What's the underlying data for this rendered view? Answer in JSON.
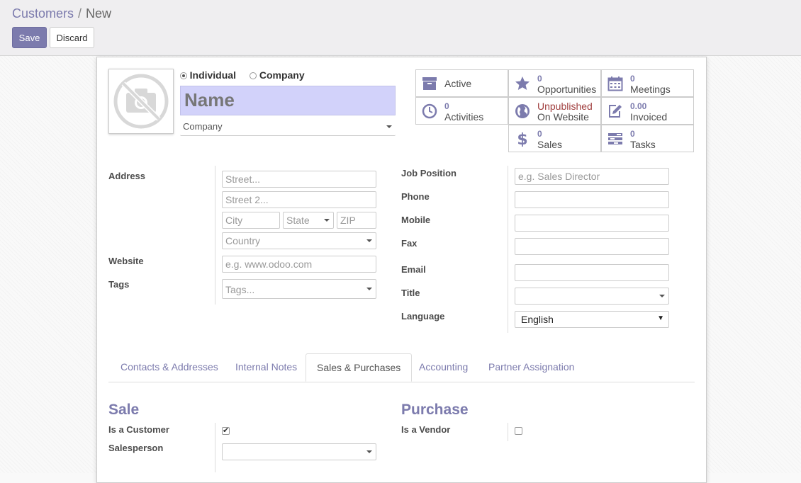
{
  "breadcrumb": {
    "parent": "Customers",
    "separator": "/",
    "current": "New"
  },
  "buttons": {
    "save": "Save",
    "discard": "Discard"
  },
  "partner_type": {
    "individual": "Individual",
    "company": "Company",
    "selected": "Individual"
  },
  "name_placeholder": "Name",
  "company_placeholder": "Company",
  "stats": {
    "active": {
      "label": "Active",
      "icon": "archive-icon"
    },
    "activities": {
      "num": "0",
      "label": "Activities",
      "icon": "clock-icon"
    },
    "opportunities": {
      "num": "0",
      "label": "Opportunities",
      "icon": "star-icon"
    },
    "website": {
      "status": "Unpublished",
      "label": "On Website",
      "icon": "globe-icon"
    },
    "sales": {
      "num": "0",
      "label": "Sales",
      "icon": "dollar-icon"
    },
    "meetings": {
      "num": "0",
      "label": "Meetings",
      "icon": "calendar-icon"
    },
    "invoiced": {
      "num": "0.00",
      "label": "Invoiced",
      "icon": "edit-icon"
    },
    "tasks": {
      "num": "0",
      "label": "Tasks",
      "icon": "tasks-icon"
    }
  },
  "address": {
    "label": "Address",
    "street": "Street...",
    "street2": "Street 2...",
    "city": "City",
    "state": "State",
    "zip": "ZIP",
    "country": "Country"
  },
  "website": {
    "label": "Website",
    "placeholder": "e.g. www.odoo.com"
  },
  "tags": {
    "label": "Tags",
    "placeholder": "Tags..."
  },
  "right_fields": {
    "job_position": {
      "label": "Job Position",
      "placeholder": "e.g. Sales Director"
    },
    "phone": {
      "label": "Phone"
    },
    "mobile": {
      "label": "Mobile"
    },
    "fax": {
      "label": "Fax"
    },
    "email": {
      "label": "Email"
    },
    "title": {
      "label": "Title"
    },
    "language": {
      "label": "Language",
      "value": "English"
    }
  },
  "tabs": [
    "Contacts & Addresses",
    "Internal Notes",
    "Sales & Purchases",
    "Accounting",
    "Partner Assignation"
  ],
  "active_tab": "Sales & Purchases",
  "sale": {
    "heading": "Sale",
    "is_customer_label": "Is a Customer",
    "is_customer": true,
    "salesperson_label": "Salesperson"
  },
  "purchase": {
    "heading": "Purchase",
    "is_vendor_label": "Is a Vendor",
    "is_vendor": false
  },
  "colors": {
    "brand": "#7c7bad",
    "name_bg": "#d2d2fa",
    "unpublished": "#a03e3e"
  }
}
